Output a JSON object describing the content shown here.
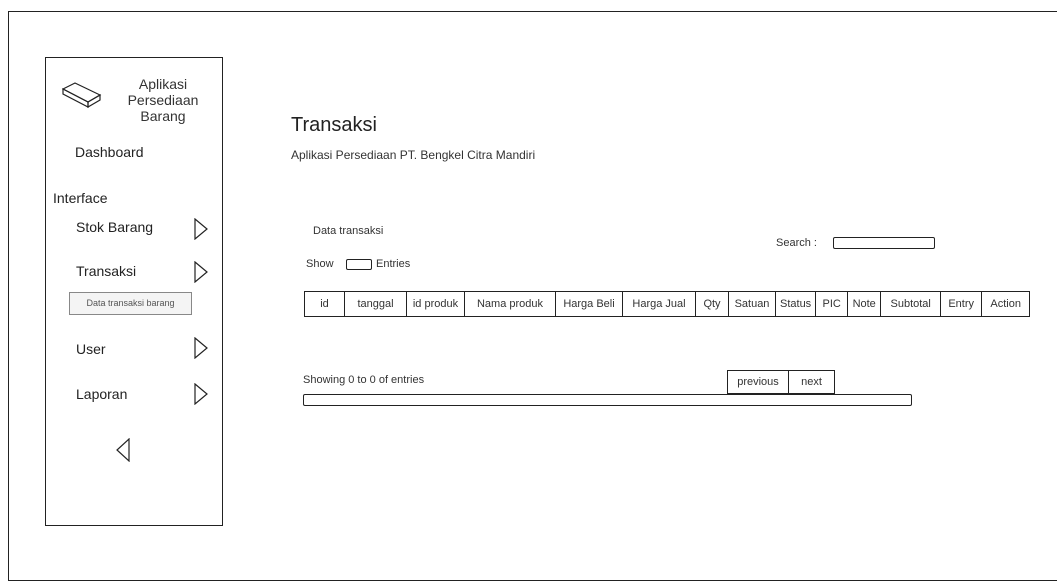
{
  "sidebar": {
    "app_name": "Aplikasi Persediaan Barang",
    "logo_icon": "box-icon",
    "dashboard": "Dashboard",
    "section_label": "Interface",
    "items": [
      {
        "label": "Stok Barang",
        "icon": "chevron-right-icon"
      },
      {
        "label": "Transaksi",
        "icon": "chevron-right-icon"
      },
      {
        "label": "User",
        "icon": "chevron-right-icon"
      },
      {
        "label": "Laporan",
        "icon": "chevron-right-icon"
      }
    ],
    "submenu_item": "Data transaksi barang",
    "collapse_icon": "chevron-left-icon"
  },
  "header": {
    "title": "Transaksi",
    "subtitle": "Aplikasi Persediaan PT. Bengkel Citra Mandiri"
  },
  "panel": {
    "heading": "Data transaksi",
    "show_label": "Show",
    "entries_label": "Entries",
    "search_label": "Search :",
    "search_value": "",
    "columns": [
      "id",
      "tanggal",
      "id produk",
      "Nama produk",
      "Harga Beli",
      "Harga Jual",
      "Qty",
      "Satuan",
      "Status",
      "PIC",
      "Note",
      "Subtotal",
      "Entry",
      "Action"
    ],
    "info": "Showing 0 to 0 of entries",
    "previous_label": "previous",
    "next_label": "next"
  }
}
